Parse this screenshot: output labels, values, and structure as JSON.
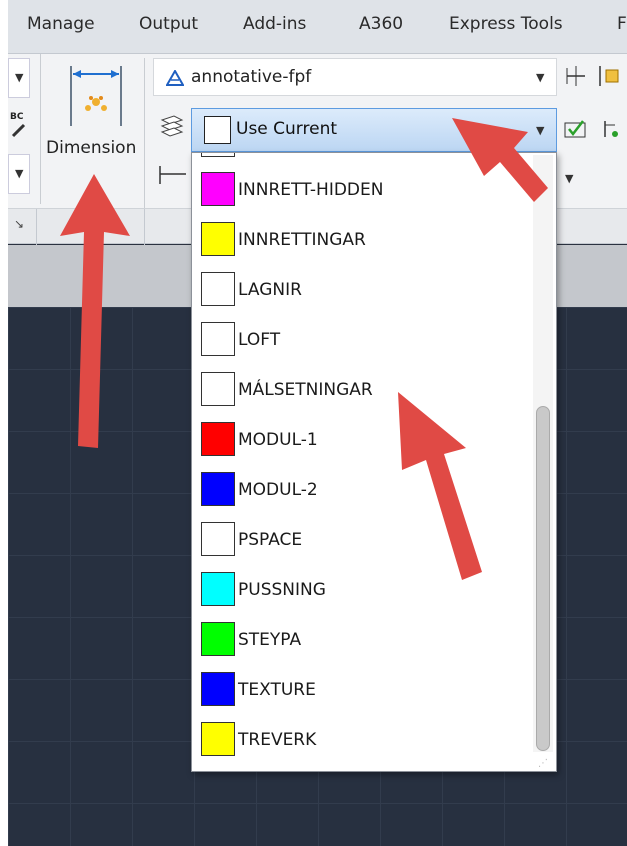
{
  "menubar": {
    "items": [
      "Manage",
      "Output",
      "Add-ins",
      "A360",
      "Express Tools",
      "F"
    ]
  },
  "ribbon": {
    "dimension_label": "Dimension",
    "dim_style": "annotative-fpf",
    "layer_current": "Use Current",
    "left_icon_text": "BC"
  },
  "layer_list": [
    {
      "name": "INNRETT-HIDDEN",
      "color": "#ff00ff"
    },
    {
      "name": "INNRETTINGAR",
      "color": "#ffff00"
    },
    {
      "name": "LAGNIR",
      "color": "#ffffff"
    },
    {
      "name": "LOFT",
      "color": "#ffffff"
    },
    {
      "name": "MÁLSETNINGAR",
      "color": "#ffffff"
    },
    {
      "name": "MODUL-1",
      "color": "#ff0000"
    },
    {
      "name": "MODUL-2",
      "color": "#0000ff"
    },
    {
      "name": "PSPACE",
      "color": "#ffffff"
    },
    {
      "name": "PUSSNING",
      "color": "#00ffff"
    },
    {
      "name": "STEYPA",
      "color": "#00ff00"
    },
    {
      "name": "TEXTURE",
      "color": "#0000ff"
    },
    {
      "name": "TREVERK",
      "color": "#ffff00"
    }
  ],
  "colors": {
    "accent_highlight": "#bcd6f3",
    "annotation_arrow": "#e04a45"
  }
}
